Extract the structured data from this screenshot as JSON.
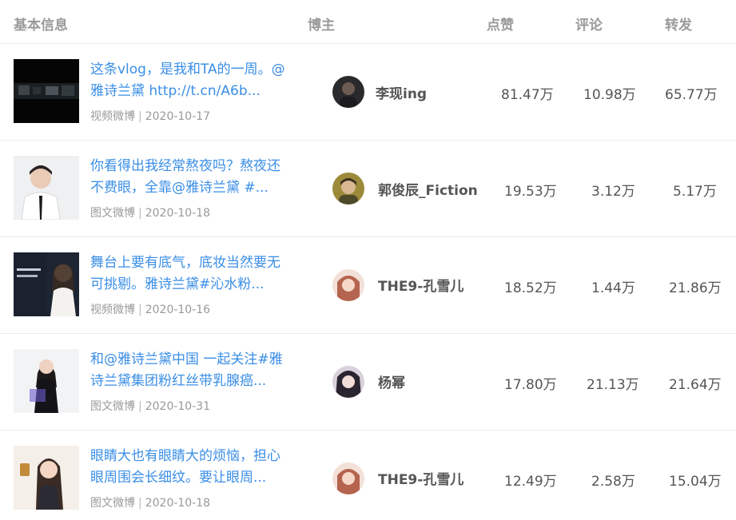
{
  "header": {
    "basic_info": "基本信息",
    "blogger": "博主",
    "likes": "点赞",
    "comments": "评论",
    "shares": "转发"
  },
  "rows": [
    {
      "text": "这条vlog，是我和TA的一周。@雅诗兰黛 http://t.cn/A6b...",
      "type": "视频微博",
      "date": "2020-10-17",
      "blogger": "李现ing",
      "likes": "81.47万",
      "comments": "10.98万",
      "shares": "65.77万"
    },
    {
      "text": "你看得出我经常熬夜吗？熬夜还不费眼，全靠@雅诗兰黛 #...",
      "type": "图文微博",
      "date": "2020-10-18",
      "blogger": "郭俊辰_Fiction",
      "likes": "19.53万",
      "comments": "3.12万",
      "shares": "5.17万"
    },
    {
      "text": "舞台上要有底气，底妆当然要无可挑剔。雅诗兰黛#沁水粉...",
      "type": "视频微博",
      "date": "2020-10-16",
      "blogger": "THE9-孔雪儿",
      "likes": "18.52万",
      "comments": "1.44万",
      "shares": "21.86万"
    },
    {
      "text": "和@雅诗兰黛中国 一起关注#雅诗兰黛集团粉红丝带乳腺癌...",
      "type": "图文微博",
      "date": "2020-10-31",
      "blogger": "杨幂",
      "likes": "17.80万",
      "comments": "21.13万",
      "shares": "21.64万"
    },
    {
      "text": "眼睛大也有眼睛大的烦恼，担心眼周围会长细纹。要让眼周...",
      "type": "图文微博",
      "date": "2020-10-18",
      "blogger": "THE9-孔雪儿",
      "likes": "12.49万",
      "comments": "2.58万",
      "shares": "15.04万"
    }
  ],
  "colors": {
    "link": "#3a8ee6",
    "header_text": "#9a9a9a",
    "meta_text": "#999999",
    "divider": "#ececec"
  }
}
